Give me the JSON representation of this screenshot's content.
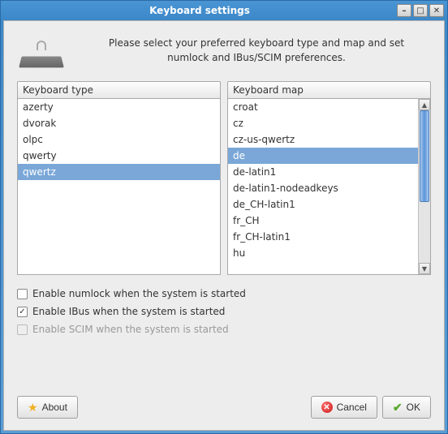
{
  "window": {
    "title": "Keyboard settings"
  },
  "instructions": "Please select your preferred keyboard type and map and set numlock and IBus/SCIM preferences.",
  "keyboard_type": {
    "header": "Keyboard type",
    "items": [
      "azerty",
      "dvorak",
      "olpc",
      "qwerty",
      "qwertz"
    ],
    "selected_index": 4
  },
  "keyboard_map": {
    "header": "Keyboard map",
    "items": [
      "croat",
      "cz",
      "cz-us-qwertz",
      "de",
      "de-latin1",
      "de-latin1-nodeadkeys",
      "de_CH-latin1",
      "fr_CH",
      "fr_CH-latin1",
      "hu"
    ],
    "selected_index": 3
  },
  "checkboxes": {
    "numlock": {
      "label": "Enable numlock when the system is started",
      "checked": false,
      "enabled": true
    },
    "ibus": {
      "label": "Enable IBus when the system is started",
      "checked": true,
      "enabled": true
    },
    "scim": {
      "label": "Enable SCIM when the system is started",
      "checked": false,
      "enabled": false
    }
  },
  "buttons": {
    "about": "About",
    "cancel": "Cancel",
    "ok": "OK"
  }
}
